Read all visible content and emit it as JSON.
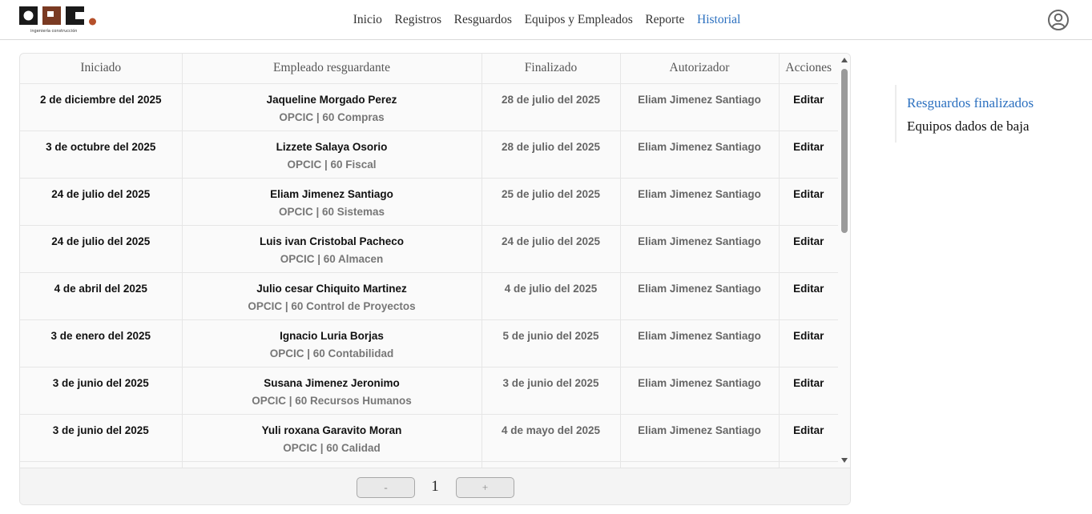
{
  "header": {
    "logo_text": "OPC",
    "logo_tagline": "ingeniería construcción",
    "nav": [
      {
        "label": "Inicio",
        "active": false
      },
      {
        "label": "Registros",
        "active": false
      },
      {
        "label": "Resguardos",
        "active": false
      },
      {
        "label": "Equipos y Empleados",
        "active": false
      },
      {
        "label": "Reporte",
        "active": false
      },
      {
        "label": "Historial",
        "active": true
      }
    ],
    "user_icon": "user-circle-icon"
  },
  "table": {
    "columns": [
      "Iniciado",
      "Empleado resguardante",
      "Finalizado",
      "Autorizador",
      "Acciones"
    ],
    "rows": [
      {
        "start": "2 de diciembre del 2025",
        "name": "Jaqueline Morgado Perez",
        "dept": "OPCIC | 60 Compras",
        "end": "28 de julio del 2025",
        "auth": "Eliam Jimenez Santiago",
        "action": "Editar"
      },
      {
        "start": "3 de octubre del 2025",
        "name": "Lizzete Salaya Osorio",
        "dept": "OPCIC | 60 Fiscal",
        "end": "28 de julio del 2025",
        "auth": "Eliam Jimenez Santiago",
        "action": "Editar"
      },
      {
        "start": "24 de julio del 2025",
        "name": "Eliam Jimenez Santiago",
        "dept": "OPCIC | 60 Sistemas",
        "end": "25 de julio del 2025",
        "auth": "Eliam Jimenez Santiago",
        "action": "Editar"
      },
      {
        "start": "24 de julio del 2025",
        "name": "Luis ivan Cristobal Pacheco",
        "dept": "OPCIC | 60 Almacen",
        "end": "24 de julio del 2025",
        "auth": "Eliam Jimenez Santiago",
        "action": "Editar"
      },
      {
        "start": "4 de abril del 2025",
        "name": "Julio cesar Chiquito Martinez",
        "dept": "OPCIC | 60 Control de Proyectos",
        "end": "4 de julio del 2025",
        "auth": "Eliam Jimenez Santiago",
        "action": "Editar"
      },
      {
        "start": "3 de enero del 2025",
        "name": "Ignacio Luria Borjas",
        "dept": "OPCIC | 60 Contabilidad",
        "end": "5 de junio del 2025",
        "auth": "Eliam Jimenez Santiago",
        "action": "Editar"
      },
      {
        "start": "3 de junio del 2025",
        "name": "Susana Jimenez Jeronimo",
        "dept": "OPCIC | 60 Recursos Humanos",
        "end": "3 de junio del 2025",
        "auth": "Eliam Jimenez Santiago",
        "action": "Editar"
      },
      {
        "start": "3 de junio del 2025",
        "name": "Yuli roxana Garavito Moran",
        "dept": "OPCIC | 60 Calidad",
        "end": "4 de mayo del 2025",
        "auth": "Eliam Jimenez Santiago",
        "action": "Editar"
      },
      {
        "start": "",
        "name": "",
        "dept": "",
        "end": "",
        "auth": "",
        "action": ""
      }
    ]
  },
  "pager": {
    "prev_label": "-",
    "page": "1",
    "next_label": "+"
  },
  "side_menu": [
    {
      "label": "Resguardos finalizados",
      "active": true
    },
    {
      "label": "Equipos dados de baja",
      "active": false
    }
  ],
  "colors": {
    "accent": "#2a6fbf",
    "logo_dark": "#1a1a1a",
    "logo_brown": "#7a3a22",
    "logo_orange": "#b5502a"
  }
}
